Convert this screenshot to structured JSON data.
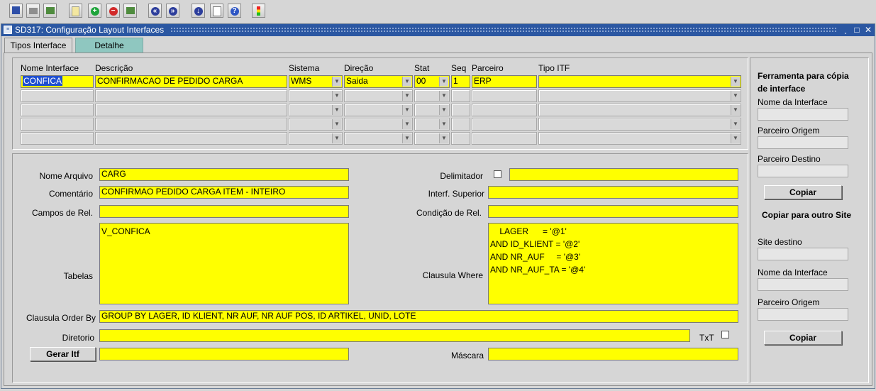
{
  "toolbar": {
    "icons": [
      "save-icon",
      "print-icon",
      "run-icon",
      "new-icon",
      "add-icon",
      "remove-icon",
      "refresh-icon",
      "previous-icon",
      "next-icon",
      "down-icon",
      "edit-icon",
      "help-icon",
      "traffic-light-icon"
    ]
  },
  "window": {
    "title": "SD317: Configuração Layout Interfaces",
    "controls": [
      "˯",
      "□",
      "✕"
    ]
  },
  "tabs": [
    {
      "label": "Tipos Interface",
      "active": true
    },
    {
      "label": "Detalhe",
      "active": false
    }
  ],
  "grid": {
    "headers": {
      "nome": "Nome Interface",
      "descricao": "Descrição",
      "sistema": "Sistema",
      "direcao": "Direção",
      "stat": "Stat",
      "seq": "Seq",
      "parceiro": "Parceiro",
      "tipo": "Tipo ITF"
    },
    "row1": {
      "nome": "CONFICA",
      "descricao": "CONFIRMACAO DE PEDIDO CARGA",
      "sistema": "WMS",
      "direcao": "Saida",
      "stat": "00",
      "seq": "1",
      "parceiro": "ERP",
      "tipo": ""
    }
  },
  "detail": {
    "nome_arquivo_label": "Nome Arquivo",
    "nome_arquivo": "CARG",
    "comentario_label": "Comentário",
    "comentario": "CONFIRMAO PEDIDO CARGA ITEM - INTEIRO",
    "campos_rel_label": "Campos de Rel.",
    "campos_rel": "",
    "tabelas_label": "Tabelas",
    "tabelas": "V_CONFICA",
    "delimitador_label": "Delimitador",
    "delimitador": "",
    "interf_superior_label": "Interf. Superior",
    "interf_superior": "",
    "condicao_rel_label": "Condição de Rel.",
    "condicao_rel": "",
    "clausula_where_label": "Clausula Where",
    "clausula_where": "    LAGER      = '@1'\nAND ID_KLIENT = '@2'\nAND NR_AUF     = '@3'\nAND NR_AUF_TA = '@4'",
    "order_by_label": "Clausula Order By",
    "order_by": "GROUP BY LAGER, ID  KLIENT, NR  AUF, NR  AUF  POS, ID  ARTIKEL, UNID, LOTE",
    "diretorio_label": "Diretorio",
    "diretorio": "",
    "txt_label": "TxT",
    "gerar_itf_label": "Gerar Itf",
    "gerar_itf_value": "",
    "mascara_label": "Máscara",
    "mascara": ""
  },
  "side": {
    "copy_title": "Ferramenta para cópia de interface",
    "nome_interface_label": "Nome da Interface",
    "parceiro_origem_label": "Parceiro Origem",
    "parceiro_destino_label": "Parceiro Destino",
    "copiar_label": "Copiar",
    "other_site_title": "Copiar para outro Site",
    "site_destino_label": "Site destino",
    "nome_interface2_label": "Nome da Interface",
    "parceiro_origem2_label": "Parceiro Origem",
    "copiar2_label": "Copiar"
  }
}
